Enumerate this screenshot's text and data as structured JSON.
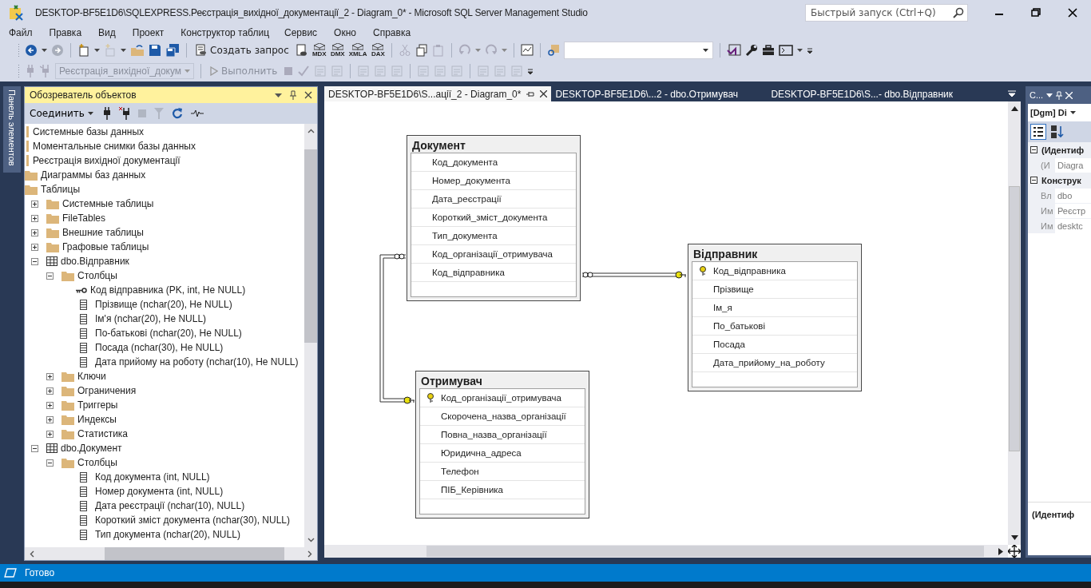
{
  "window": {
    "title": "DESKTOP-BF5E1D6\\SQLEXPRESS.Реєстрація_вихідної_документації_2 - Diagram_0* - Microsoft SQL Server Management Studio",
    "quick_launch": {
      "placeholder": "Быстрый запуск (Ctrl+Q)"
    }
  },
  "menu": [
    "Файл",
    "Правка",
    "Вид",
    "Проект",
    "Конструктор таблиц",
    "Сервис",
    "Окно",
    "Справка"
  ],
  "toolbar": {
    "new_query": "Создать запрос",
    "query_types": [
      "MDX",
      "DMX",
      "XMLA",
      "DAX"
    ],
    "database": {
      "value": "Реєстрація_вихідної_докум",
      "disabled": true
    },
    "execute": {
      "label": "Выполнить",
      "disabled": true
    }
  },
  "side_tab": "Панель элементов",
  "object_explorer": {
    "title": "Обозреватель объектов",
    "connect": "Соединить",
    "tree": [
      {
        "label": "Системные базы данных",
        "kind": "database"
      },
      {
        "label": "Моментальные снимки базы данных",
        "kind": "database"
      },
      {
        "label": "Реєстрація вихідної документації",
        "kind": "database",
        "children": [
          {
            "label": "Диаграммы баз данных",
            "kind": "folder"
          },
          {
            "label": "Таблицы",
            "kind": "folder",
            "children": [
              {
                "label": "Системные таблицы",
                "kind": "folder",
                "expanded": false
              },
              {
                "label": "FileTables",
                "kind": "folder",
                "expanded": false
              },
              {
                "label": "Внешние таблицы",
                "kind": "folder",
                "expanded": false
              },
              {
                "label": "Графовые таблицы",
                "kind": "folder",
                "expanded": false
              },
              {
                "label": "dbo.Відправник",
                "kind": "table",
                "expanded": true,
                "children": [
                  {
                    "label": "Столбцы",
                    "kind": "folder",
                    "expanded": true,
                    "children": [
                      {
                        "label": "Код відправника (PK, int, Не NULL)",
                        "kind": "key"
                      },
                      {
                        "label": "Прізвище (nchar(20), Не NULL)",
                        "kind": "column"
                      },
                      {
                        "label": "Ім'я (nchar(20), Не NULL)",
                        "kind": "column"
                      },
                      {
                        "label": "По-батькові (nchar(20), Не NULL)",
                        "kind": "column"
                      },
                      {
                        "label": "Посада (nchar(30), Не NULL)",
                        "kind": "column"
                      },
                      {
                        "label": "Дата прийому на роботу (nchar(10), Не NULL)",
                        "kind": "column"
                      }
                    ]
                  },
                  {
                    "label": "Ключи",
                    "kind": "folder",
                    "expanded": false
                  },
                  {
                    "label": "Ограничения",
                    "kind": "folder",
                    "expanded": false
                  },
                  {
                    "label": "Триггеры",
                    "kind": "folder",
                    "expanded": false
                  },
                  {
                    "label": "Индексы",
                    "kind": "folder",
                    "expanded": false
                  },
                  {
                    "label": "Статистика",
                    "kind": "folder",
                    "expanded": false
                  }
                ]
              },
              {
                "label": "dbo.Документ",
                "kind": "table",
                "expanded": true,
                "children": [
                  {
                    "label": "Столбцы",
                    "kind": "folder",
                    "expanded": true,
                    "children": [
                      {
                        "label": "Код документа (int, NULL)",
                        "kind": "column"
                      },
                      {
                        "label": "Номер документа (int, NULL)",
                        "kind": "column"
                      },
                      {
                        "label": "Дата реєстрації (nchar(10), NULL)",
                        "kind": "column"
                      },
                      {
                        "label": "Короткий зміст документа (nchar(30), NULL)",
                        "kind": "column"
                      },
                      {
                        "label": "Тип документа (nchar(20), NULL)",
                        "kind": "column"
                      }
                    ]
                  }
                ]
              }
            ]
          }
        ]
      }
    ]
  },
  "tabs": [
    {
      "label": "DESKTOP-BF5E1D6\\S...ації_2 - Diagram_0*",
      "selected": true
    },
    {
      "label": "DESKTOP-BF5E1D6\\...2 - dbo.Отримувач",
      "selected": false
    },
    {
      "label": "DESKTOP-BF5E1D6\\S...- dbo.Відправник",
      "selected": false
    }
  ],
  "diagram": {
    "tables": [
      {
        "name": "Документ",
        "columns": [
          {
            "name": "Код_документа",
            "primary_key": false
          },
          {
            "name": "Номер_документа",
            "primary_key": false
          },
          {
            "name": "Дата_реєстрації",
            "primary_key": false
          },
          {
            "name": "Короткий_зміст_документа",
            "primary_key": false
          },
          {
            "name": "Тип_документа",
            "primary_key": false
          },
          {
            "name": "Код_організації_отримувача",
            "primary_key": false
          },
          {
            "name": "Код_відправника",
            "primary_key": false
          }
        ]
      },
      {
        "name": "Відправник",
        "columns": [
          {
            "name": "Код_відправника",
            "primary_key": true
          },
          {
            "name": "Прізвище",
            "primary_key": false
          },
          {
            "name": "Ім_я",
            "primary_key": false
          },
          {
            "name": "По_батькові",
            "primary_key": false
          },
          {
            "name": "Посада",
            "primary_key": false
          },
          {
            "name": "Дата_прийому_на_роботу",
            "primary_key": false
          }
        ]
      },
      {
        "name": "Отримувач",
        "columns": [
          {
            "name": "Код_організації_отримувача",
            "primary_key": true
          },
          {
            "name": "Скорочена_назва_організації",
            "primary_key": false
          },
          {
            "name": "Повна_назва_організації",
            "primary_key": false
          },
          {
            "name": "Юридична_адреса",
            "primary_key": false
          },
          {
            "name": "Телефон",
            "primary_key": false
          },
          {
            "name": "ПІБ_Керівника",
            "primary_key": false
          }
        ]
      }
    ]
  },
  "properties": {
    "title": "С...",
    "object": "[Dgm] Di",
    "rows": [
      {
        "kind": "category",
        "name": "(Идентиф",
        "expanded": true
      },
      {
        "kind": "property",
        "name": "(И",
        "value": "Diagra"
      },
      {
        "kind": "category",
        "name": "Конструк",
        "expanded": true
      },
      {
        "kind": "property",
        "name": "Вл",
        "value": "dbo"
      },
      {
        "kind": "property",
        "name": "Им",
        "value": "Реєстр"
      },
      {
        "kind": "property",
        "name": "Им",
        "value": "desktc"
      }
    ],
    "description": "(Идентиф"
  },
  "status_bar": {
    "text": "Готово"
  }
}
